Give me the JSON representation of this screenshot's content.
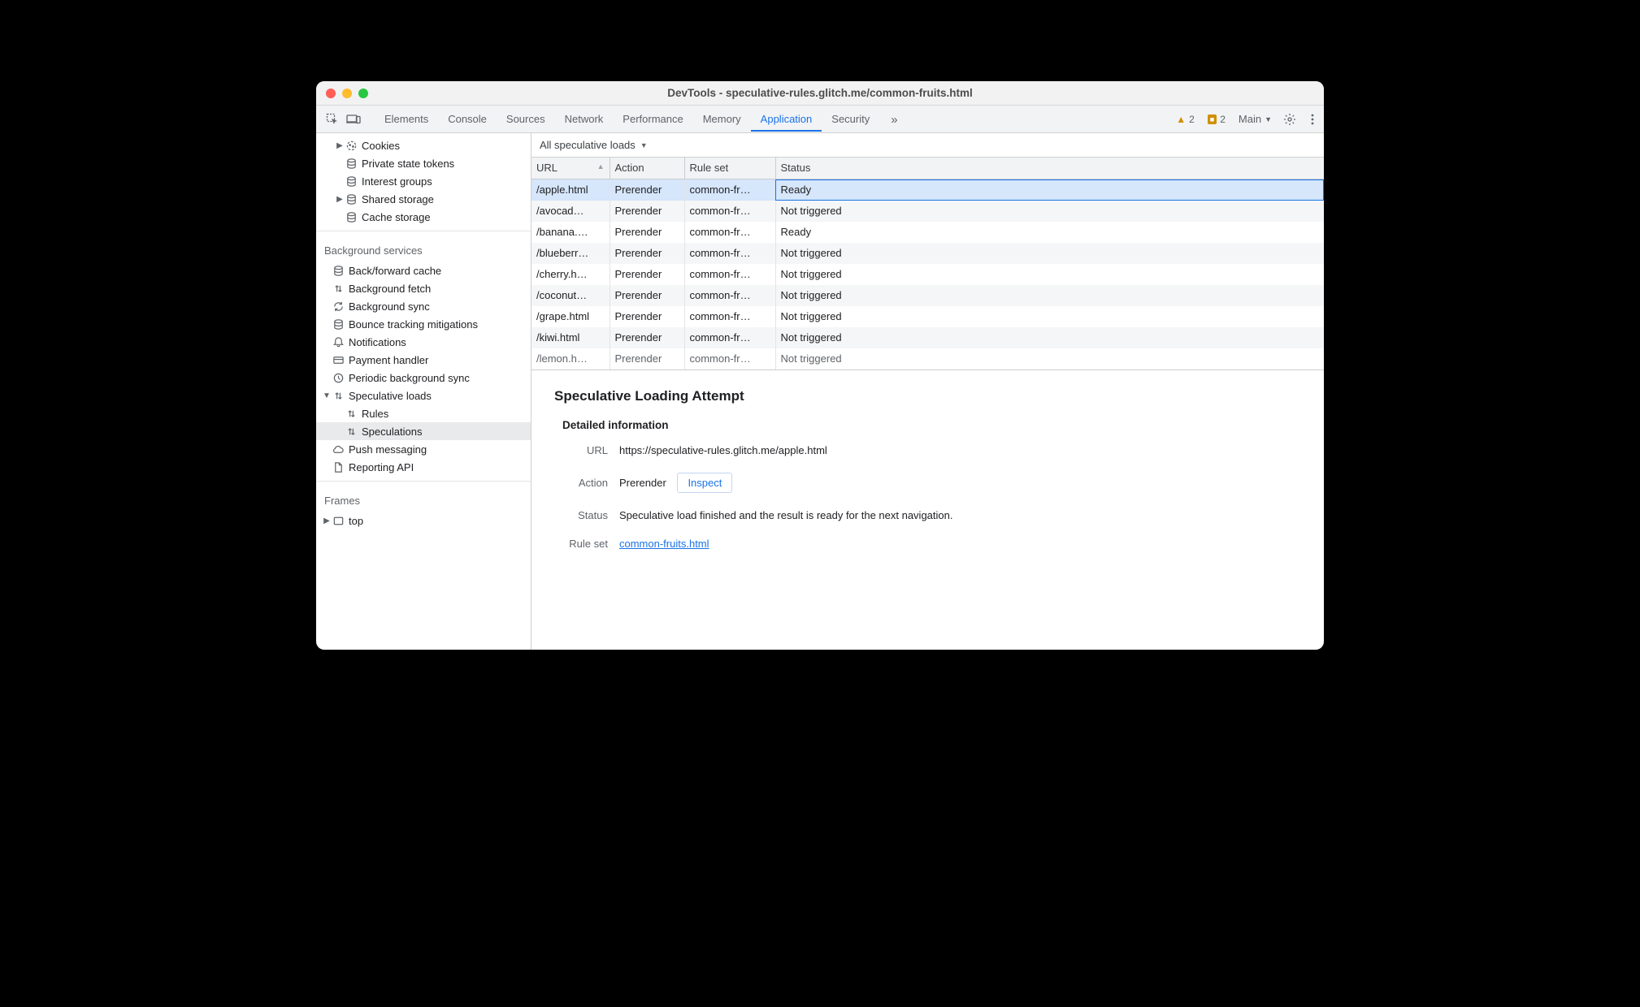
{
  "window": {
    "title": "DevTools - speculative-rules.glitch.me/common-fruits.html"
  },
  "tabs": {
    "items": [
      "Elements",
      "Console",
      "Sources",
      "Network",
      "Performance",
      "Memory",
      "Application",
      "Security"
    ],
    "overflow": "»",
    "active": "Application",
    "warnings": "2",
    "issues": "2",
    "target_label": "Main"
  },
  "sidebar": {
    "storage": [
      {
        "label": "Cookies",
        "icon": "cookie",
        "expand": true
      },
      {
        "label": "Private state tokens",
        "icon": "db"
      },
      {
        "label": "Interest groups",
        "icon": "db"
      },
      {
        "label": "Shared storage",
        "icon": "db",
        "expand": true
      },
      {
        "label": "Cache storage",
        "icon": "db"
      }
    ],
    "bg_heading": "Background services",
    "bg": [
      {
        "label": "Back/forward cache",
        "icon": "db"
      },
      {
        "label": "Background fetch",
        "icon": "updown"
      },
      {
        "label": "Background sync",
        "icon": "sync"
      },
      {
        "label": "Bounce tracking mitigations",
        "icon": "db"
      },
      {
        "label": "Notifications",
        "icon": "bell"
      },
      {
        "label": "Payment handler",
        "icon": "card"
      },
      {
        "label": "Periodic background sync",
        "icon": "clock"
      },
      {
        "label": "Speculative loads",
        "icon": "updown",
        "expand": true,
        "open": true,
        "children": [
          {
            "label": "Rules",
            "icon": "updown"
          },
          {
            "label": "Speculations",
            "icon": "updown",
            "selected": true
          }
        ]
      },
      {
        "label": "Push messaging",
        "icon": "cloud"
      },
      {
        "label": "Reporting API",
        "icon": "doc"
      }
    ],
    "frames_heading": "Frames",
    "frames": [
      {
        "label": "top",
        "icon": "frame",
        "expand": true
      }
    ]
  },
  "filter": {
    "label": "All speculative loads"
  },
  "columns": {
    "url": "URL",
    "action": "Action",
    "ruleset": "Rule set",
    "status": "Status"
  },
  "rows": [
    {
      "url": "/apple.html",
      "action": "Prerender",
      "ruleset": "common-fr…",
      "status": "Ready",
      "selected": true
    },
    {
      "url": "/avocad…",
      "action": "Prerender",
      "ruleset": "common-fr…",
      "status": "Not triggered"
    },
    {
      "url": "/banana.…",
      "action": "Prerender",
      "ruleset": "common-fr…",
      "status": "Ready"
    },
    {
      "url": "/blueberr…",
      "action": "Prerender",
      "ruleset": "common-fr…",
      "status": "Not triggered"
    },
    {
      "url": "/cherry.h…",
      "action": "Prerender",
      "ruleset": "common-fr…",
      "status": "Not triggered"
    },
    {
      "url": "/coconut…",
      "action": "Prerender",
      "ruleset": "common-fr…",
      "status": "Not triggered"
    },
    {
      "url": "/grape.html",
      "action": "Prerender",
      "ruleset": "common-fr…",
      "status": "Not triggered"
    },
    {
      "url": "/kiwi.html",
      "action": "Prerender",
      "ruleset": "common-fr…",
      "status": "Not triggered"
    },
    {
      "url": "/lemon.h…",
      "action": "Prerender",
      "ruleset": "common-fr…",
      "status": "Not triggered",
      "cut": true
    }
  ],
  "details": {
    "heading": "Speculative Loading Attempt",
    "sub": "Detailed information",
    "url_label": "URL",
    "url_value": "https://speculative-rules.glitch.me/apple.html",
    "action_label": "Action",
    "action_value": "Prerender",
    "inspect_label": "Inspect",
    "status_label": "Status",
    "status_value": "Speculative load finished and the result is ready for the next navigation.",
    "ruleset_label": "Rule set",
    "ruleset_value": "common-fruits.html"
  }
}
